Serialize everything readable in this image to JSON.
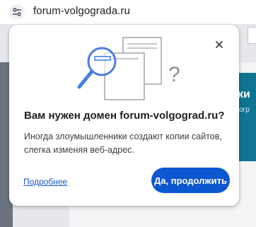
{
  "omnibox": {
    "url": "forum-volgograda.ru",
    "site_info_icon": "tune-icon"
  },
  "background_page": {
    "snippet_text": "ки",
    "snippet_sub": "огр"
  },
  "popup": {
    "title": "Вам нужен домен forum-volgograd.ru?",
    "description": "Иногда злоумышленники создают копии сайтов, слегка изменяя веб-адрес.",
    "learn_more_label": "Подробнее",
    "continue_label": "Да, продолжить",
    "close_icon": "close-icon",
    "illustration": "magnifier-pages-question-illustration"
  },
  "colors": {
    "accent": "#0b57d0",
    "link": "#1a57c9",
    "illustration_blue": "#4a7de0"
  }
}
